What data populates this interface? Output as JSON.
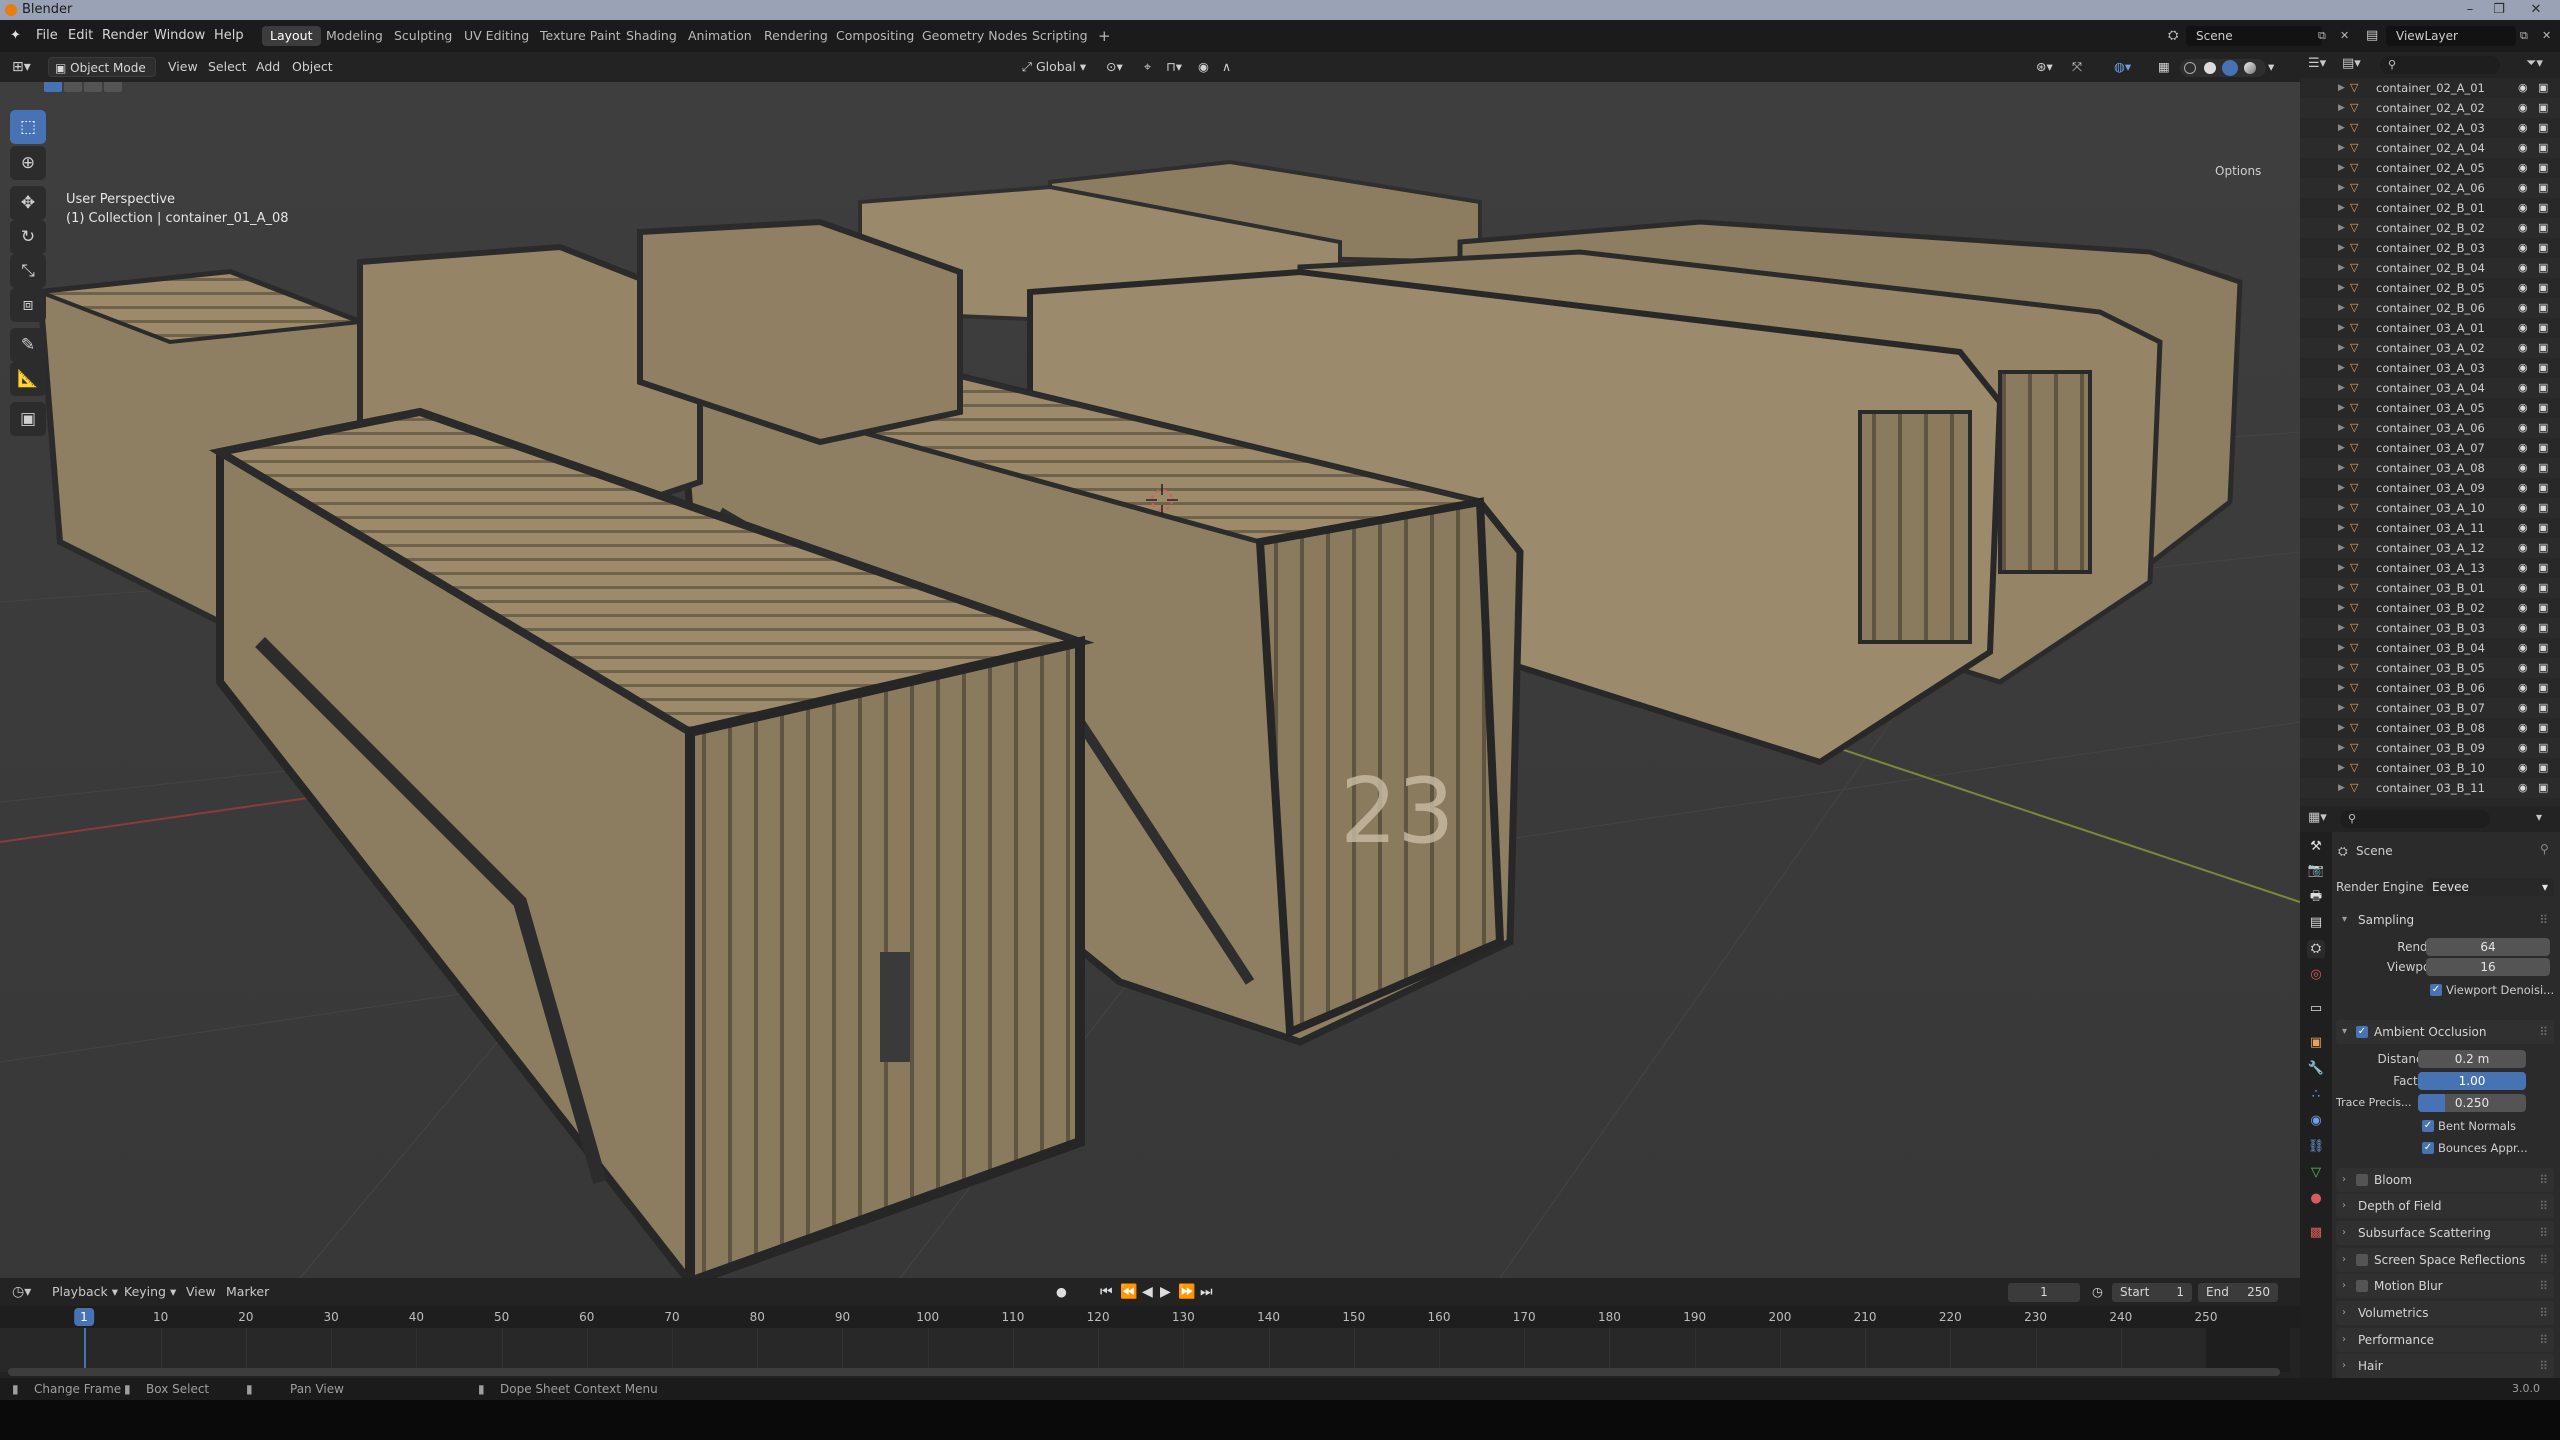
{
  "titlebar": {
    "app": "Blender"
  },
  "menubar": {
    "menus": [
      "File",
      "Edit",
      "Render",
      "Window",
      "Help"
    ],
    "workspaces": [
      "Layout",
      "Modeling",
      "Sculpting",
      "UV Editing",
      "Texture Paint",
      "Shading",
      "Animation",
      "Rendering",
      "Compositing",
      "Geometry Nodes",
      "Scripting"
    ],
    "active_workspace": "Layout",
    "add_tab": "+",
    "scene": "Scene",
    "view_layer": "ViewLayer"
  },
  "viewport_header": {
    "mode": "Object Mode",
    "menus": [
      "View",
      "Select",
      "Add",
      "Object"
    ],
    "orientation": "Global",
    "options": "Options"
  },
  "viewport": {
    "perspective": "User Perspective",
    "collection": "(1) Collection | container_01_A_08",
    "crate_number": "23"
  },
  "timeline": {
    "menus": [
      "Playback",
      "Keying",
      "View",
      "Marker"
    ],
    "current_frame": "1",
    "start_label": "Start",
    "start": "1",
    "end_label": "End",
    "end": "250",
    "ruler": [
      "1",
      "10",
      "20",
      "30",
      "40",
      "50",
      "60",
      "70",
      "80",
      "90",
      "100",
      "110",
      "120",
      "130",
      "140",
      "150",
      "160",
      "170",
      "180",
      "190",
      "200",
      "210",
      "220",
      "230",
      "240",
      "250"
    ]
  },
  "status": {
    "items": [
      "Change Frame",
      "Box Select",
      "Pan View",
      "Dope Sheet Context Menu"
    ],
    "version": "3.0.0"
  },
  "outliner": {
    "items": [
      "container_02_A_01",
      "container_02_A_02",
      "container_02_A_03",
      "container_02_A_04",
      "container_02_A_05",
      "container_02_A_06",
      "container_02_B_01",
      "container_02_B_02",
      "container_02_B_03",
      "container_02_B_04",
      "container_02_B_05",
      "container_02_B_06",
      "container_03_A_01",
      "container_03_A_02",
      "container_03_A_03",
      "container_03_A_04",
      "container_03_A_05",
      "container_03_A_06",
      "container_03_A_07",
      "container_03_A_08",
      "container_03_A_09",
      "container_03_A_10",
      "container_03_A_11",
      "container_03_A_12",
      "container_03_A_13",
      "container_03_B_01",
      "container_03_B_02",
      "container_03_B_03",
      "container_03_B_04",
      "container_03_B_05",
      "container_03_B_06",
      "container_03_B_07",
      "container_03_B_08",
      "container_03_B_09",
      "container_03_B_10",
      "container_03_B_11"
    ]
  },
  "properties": {
    "context": "Scene",
    "render_engine_label": "Render Engine",
    "render_engine": "Eevee",
    "sampling": {
      "title": "Sampling",
      "render_label": "Render",
      "render": "64",
      "viewport_label": "Viewport",
      "viewport": "16",
      "denoise": "Viewport Denoisi..."
    },
    "ao": {
      "title": "Ambient Occlusion",
      "distance_label": "Distance",
      "distance": "0.2 m",
      "factor_label": "Factor",
      "factor": "1.00",
      "trace_label": "Trace Precis...",
      "trace": "0.250",
      "trace_fill": 0.25,
      "bent_normals": "Bent Normals",
      "bounces": "Bounces Appr..."
    },
    "sections": [
      "Bloom",
      "Depth of Field",
      "Subsurface Scattering",
      "Screen Space Reflections",
      "Motion Blur",
      "Volumetrics",
      "Performance",
      "Hair"
    ]
  }
}
